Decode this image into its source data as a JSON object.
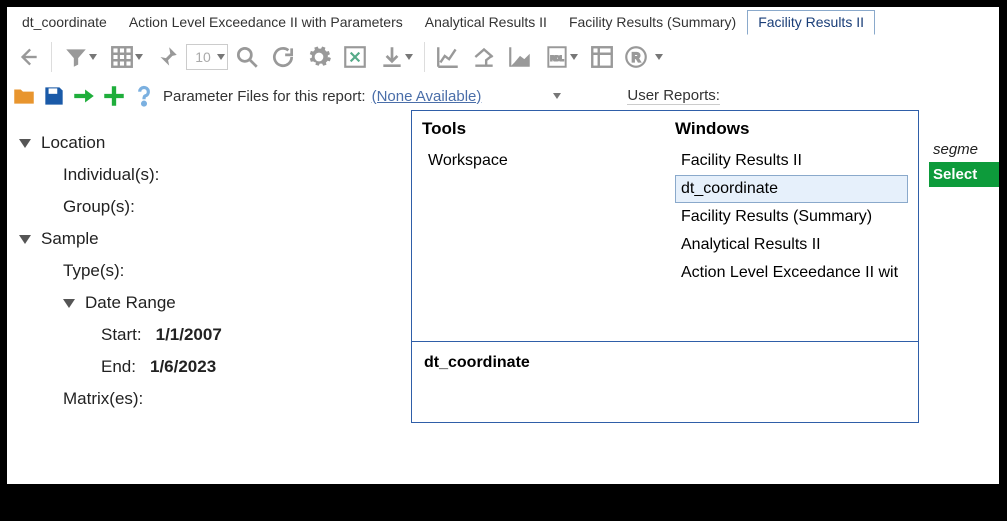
{
  "tabs": {
    "items": [
      {
        "label": "dt_coordinate",
        "active": false
      },
      {
        "label": "Action Level Exceedance II with Parameters",
        "active": false
      },
      {
        "label": "Analytical Results II",
        "active": false
      },
      {
        "label": "Facility Results (Summary)",
        "active": false
      },
      {
        "label": "Facility Results II",
        "active": true
      }
    ]
  },
  "toolbar": {
    "page_box": "10"
  },
  "row2": {
    "param_label": "Parameter Files for this report:",
    "param_link": "(None Available)",
    "user_reports_label": "User Reports:"
  },
  "tree": {
    "location": {
      "label": "Location",
      "individual": "Individual(s):",
      "group": "Group(s):"
    },
    "sample": {
      "label": "Sample",
      "types": "Type(s):",
      "daterange": {
        "label": "Date Range",
        "start_label": "Start:",
        "start_value": "1/1/2007",
        "end_label": "End:",
        "end_value": "1/6/2023"
      },
      "matrix": "Matrix(es):"
    }
  },
  "popup": {
    "tools_header": "Tools",
    "tools_items": [
      "Workspace"
    ],
    "windows_header": "Windows",
    "windows_items": [
      {
        "label": "Facility Results II",
        "selected": false
      },
      {
        "label": "dt_coordinate",
        "selected": true
      },
      {
        "label": "Facility Results (Summary)",
        "selected": false
      },
      {
        "label": "Analytical Results II",
        "selected": false
      },
      {
        "label": "Action Level Exceedance II wit",
        "selected": false
      }
    ],
    "bottom_label": "dt_coordinate"
  },
  "rstrip": {
    "header": "segme",
    "selectbtn": "Select"
  }
}
